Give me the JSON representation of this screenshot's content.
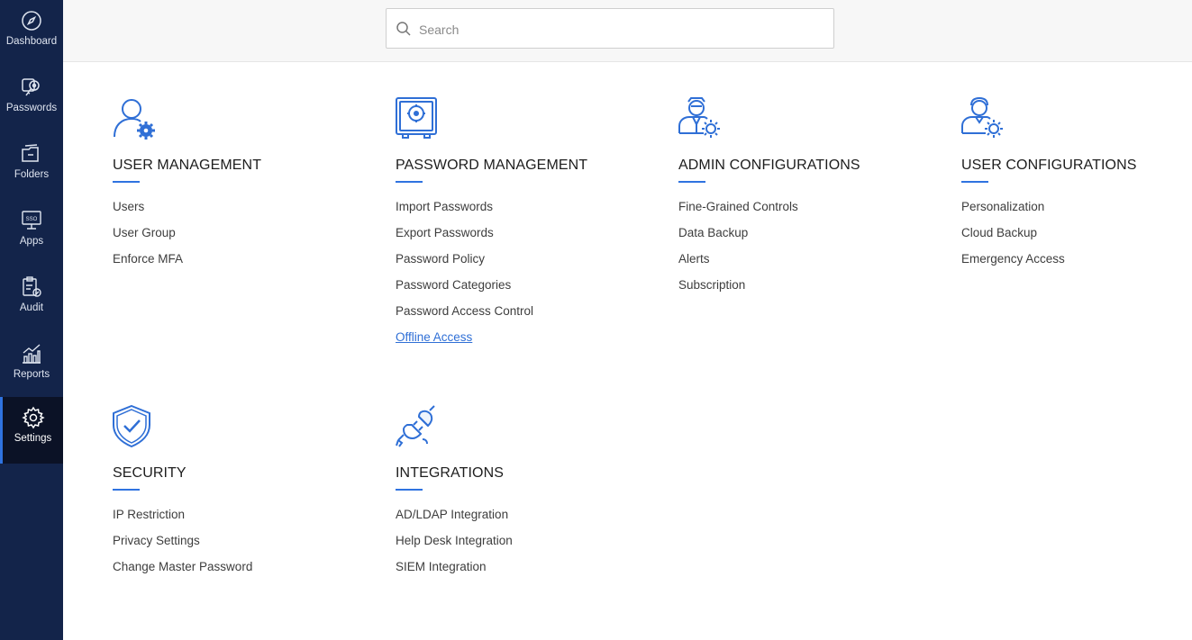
{
  "sidebar": {
    "items": [
      {
        "label": "Dashboard",
        "icon": "compass-icon"
      },
      {
        "label": "Passwords",
        "icon": "key-icon"
      },
      {
        "label": "Folders",
        "icon": "folder-icon"
      },
      {
        "label": "Apps",
        "icon": "sso-monitor-icon"
      },
      {
        "label": "Audit",
        "icon": "clipboard-check-icon"
      },
      {
        "label": "Reports",
        "icon": "bar-chart-icon"
      },
      {
        "label": "Settings",
        "icon": "gear-icon",
        "active": true
      }
    ]
  },
  "search": {
    "placeholder": "Search"
  },
  "sections": [
    {
      "title": "USER MANAGEMENT",
      "icon": "user-gear-icon",
      "links": [
        "Users",
        "User Group",
        "Enforce MFA"
      ]
    },
    {
      "title": "PASSWORD MANAGEMENT",
      "icon": "safe-icon",
      "links": [
        "Import Passwords",
        "Export Passwords",
        "Password Policy",
        "Password Categories",
        "Password Access Control",
        "Offline Access"
      ],
      "highlighted_link": "Offline Access"
    },
    {
      "title": "ADMIN CONFIGURATIONS",
      "icon": "admin-gear-icon",
      "links": [
        "Fine-Grained Controls",
        "Data Backup",
        "Alerts",
        "Subscription"
      ]
    },
    {
      "title": "USER CONFIGURATIONS",
      "icon": "user-config-icon",
      "links": [
        "Personalization",
        "Cloud Backup",
        "Emergency Access"
      ]
    },
    {
      "title": "SECURITY",
      "icon": "shield-check-icon",
      "links": [
        "IP Restriction",
        "Privacy Settings",
        "Change Master Password"
      ]
    },
    {
      "title": "INTEGRATIONS",
      "icon": "plug-icon",
      "links": [
        "AD/LDAP Integration",
        "Help Desk Integration",
        "SIEM Integration"
      ]
    }
  ],
  "colors": {
    "sidebar_bg": "#13244a",
    "sidebar_active_bg": "#0b1226",
    "accent": "#2f73e0",
    "link_active": "#2f6fd6"
  }
}
